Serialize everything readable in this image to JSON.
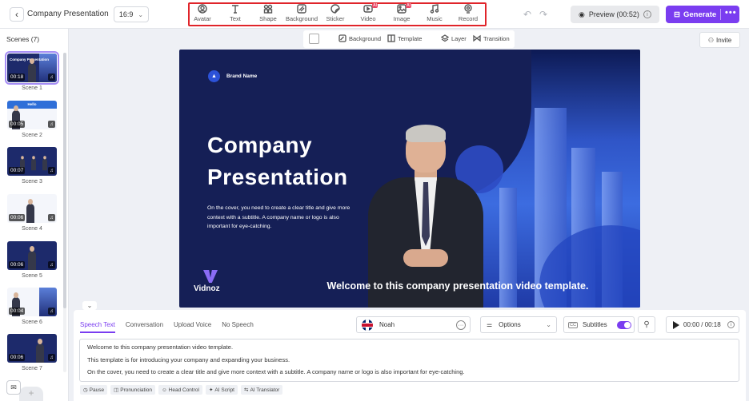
{
  "header": {
    "back_icon": "chevron-left-icon",
    "project_title": "Company Presentation",
    "aspect_ratio": "16:9",
    "tools": [
      {
        "label": "Avatar",
        "icon": "avatar-icon",
        "ai_badge": ""
      },
      {
        "label": "Text",
        "icon": "text-icon",
        "ai_badge": ""
      },
      {
        "label": "Shape",
        "icon": "shape-icon",
        "ai_badge": ""
      },
      {
        "label": "Background",
        "icon": "background-icon",
        "ai_badge": ""
      },
      {
        "label": "Sticker",
        "icon": "sticker-icon",
        "ai_badge": ""
      },
      {
        "label": "Video",
        "icon": "video-icon",
        "ai_badge": "AI"
      },
      {
        "label": "Image",
        "icon": "image-icon",
        "ai_badge": "AI"
      },
      {
        "label": "Music",
        "icon": "music-icon",
        "ai_badge": ""
      },
      {
        "label": "Record",
        "icon": "record-icon",
        "ai_badge": ""
      }
    ],
    "preview_label": "Preview (00:52)",
    "generate_label": "Generate",
    "highlight_color": "#e0242a",
    "accent_color": "#7a3df0"
  },
  "sidebar": {
    "title": "Scenes (7)",
    "scenes": [
      {
        "name": "Scene 1",
        "duration": "00:18",
        "thumb_title": "Company Presentation",
        "banner": ""
      },
      {
        "name": "Scene 2",
        "duration": "00:05",
        "thumb_title": "",
        "banner": "Hello"
      },
      {
        "name": "Scene 3",
        "duration": "00:07",
        "thumb_title": "",
        "banner": ""
      },
      {
        "name": "Scene 4",
        "duration": "00:06",
        "thumb_title": "",
        "banner": ""
      },
      {
        "name": "Scene 5",
        "duration": "00:06",
        "thumb_title": "",
        "banner": ""
      },
      {
        "name": "Scene 6",
        "duration": "00:04",
        "thumb_title": "",
        "banner": ""
      },
      {
        "name": "Scene 7",
        "duration": "00:06",
        "thumb_title": "",
        "banner": ""
      }
    ]
  },
  "canvas_toolbar": {
    "background_label": "Background",
    "template_label": "Template",
    "layer_label": "Layer",
    "transition_label": "Transition"
  },
  "invite_label": "Invite",
  "slide": {
    "brand_name": "Brand Name",
    "title_line1": "Company",
    "title_line2": "Presentation",
    "subtitle": "On the cover, you need to create a clear title and give more context with a subtitle. A company name or logo is also important for eye-catching.",
    "logo_text": "Vidnoz",
    "caption": "Welcome to this company presentation video template."
  },
  "speech": {
    "tabs": [
      "Speech Text",
      "Conversation",
      "Upload Voice",
      "No Speech"
    ],
    "active_tab": "Speech Text",
    "voice_name": "Noah",
    "options_label": "Options",
    "subtitles_label": "Subtitles",
    "subtitles_on": true,
    "time": "00:00 / 00:18",
    "script_lines": [
      "Welcome to this company presentation video template.",
      "This template is for introducing your company and expanding your business.",
      "On the cover, you need to create a clear title and give more context with a subtitle. A company name or logo is also important for eye-catching."
    ],
    "script_tools": [
      {
        "label": "Pause",
        "icon": "clock-icon"
      },
      {
        "label": "Pronunciation",
        "icon": "pronunciation-icon"
      },
      {
        "label": "Head Control",
        "icon": "head-control-icon"
      },
      {
        "label": "AI Script",
        "icon": "ai-script-icon"
      },
      {
        "label": "AI Translator",
        "icon": "translator-icon"
      }
    ]
  }
}
